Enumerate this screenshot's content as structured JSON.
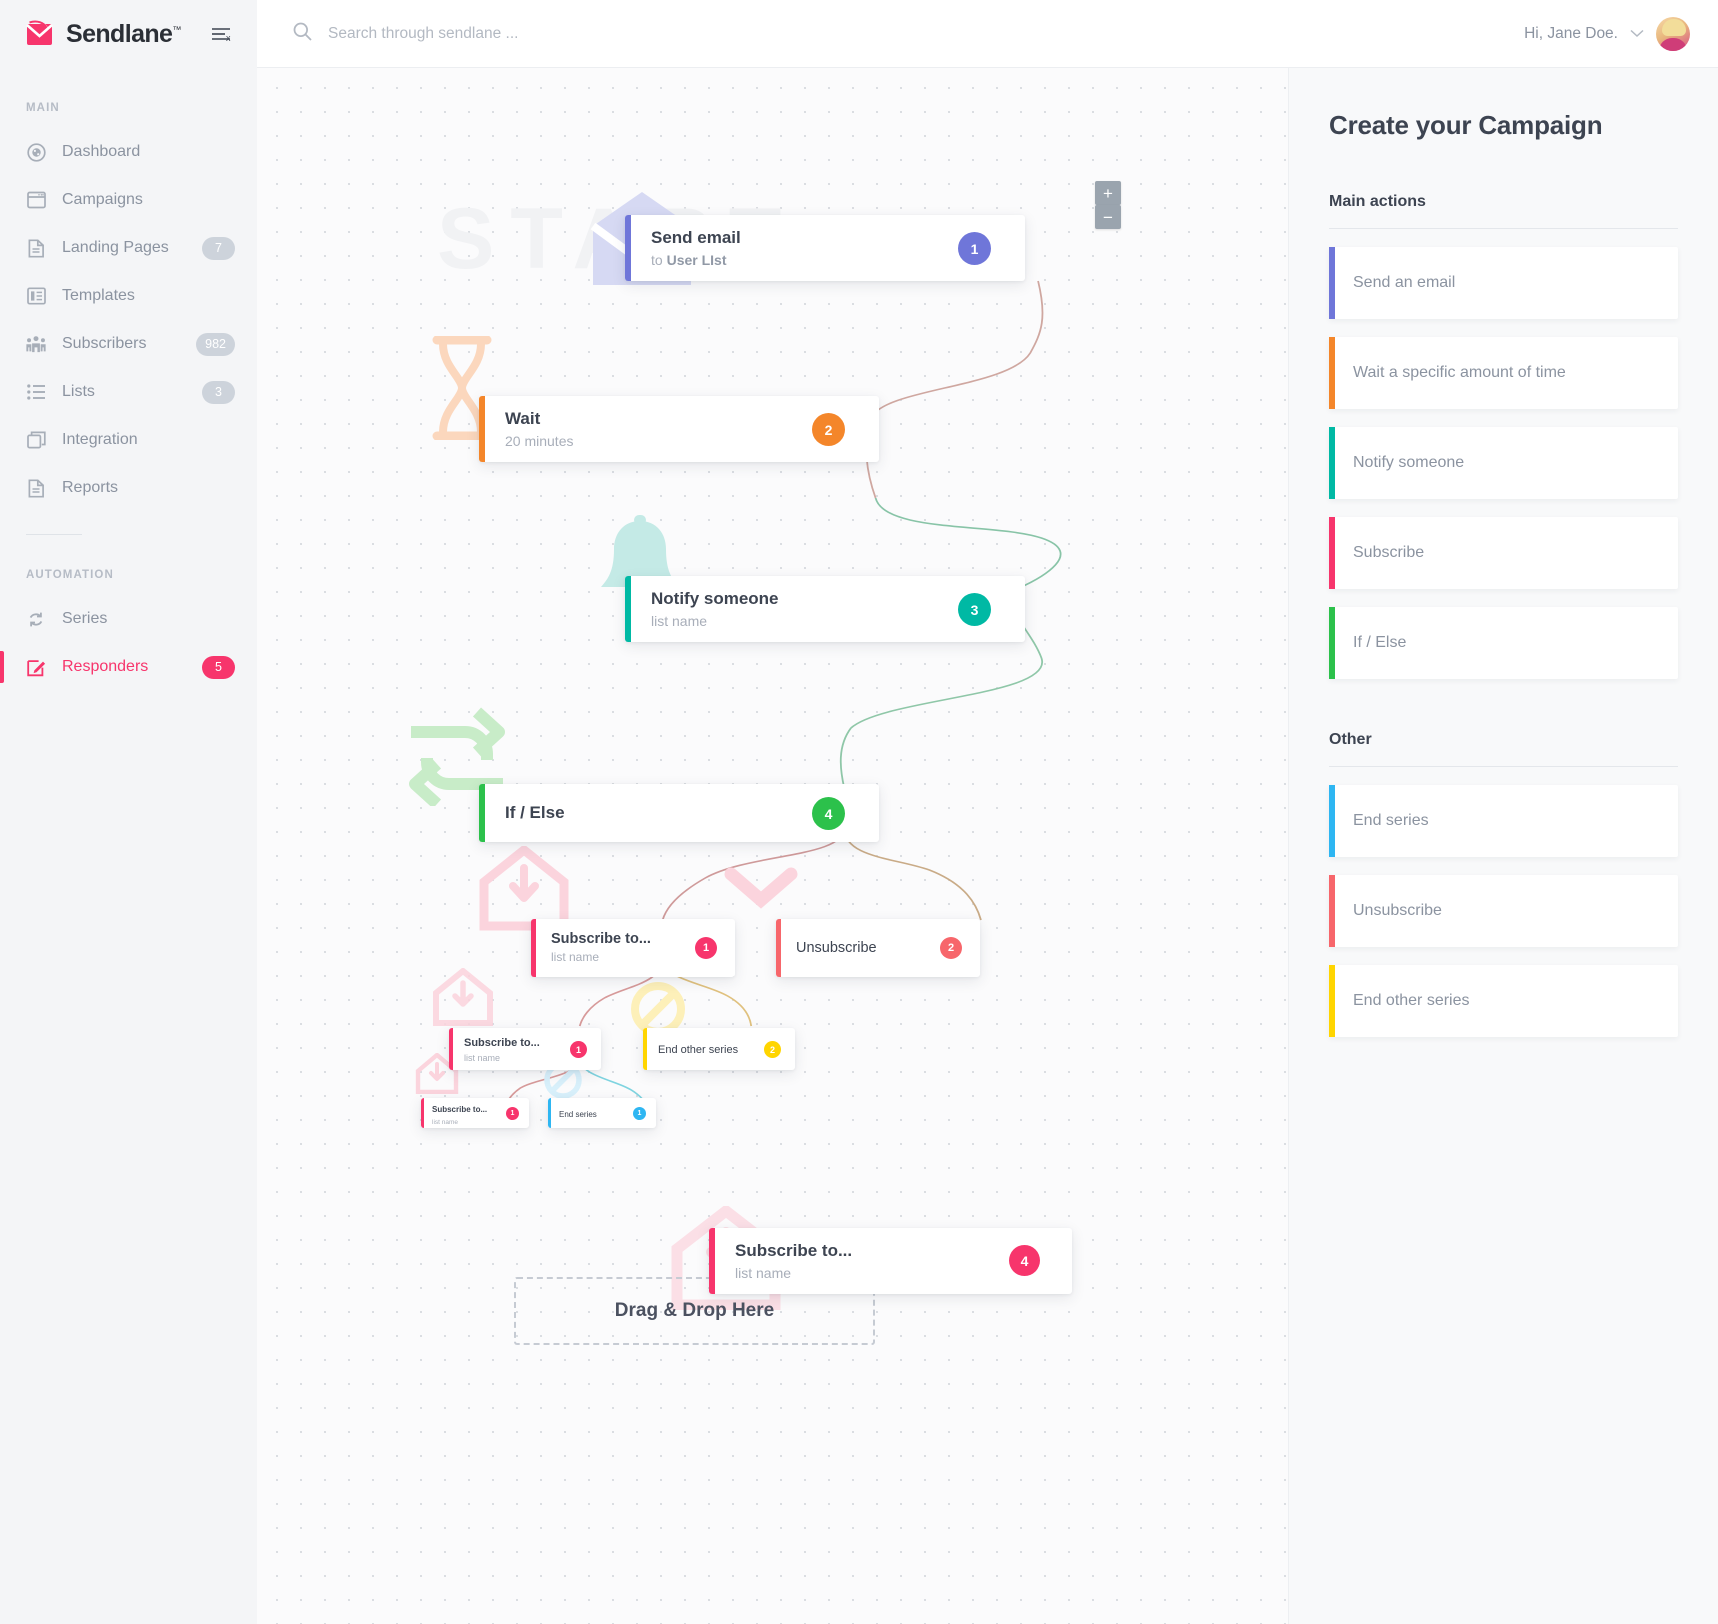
{
  "brand": {
    "name": "Sendlane",
    "tm": "™",
    "collapse_icon": "collapse-sidebar-icon"
  },
  "sidebar": {
    "sections": [
      {
        "label": "MAIN",
        "items": [
          {
            "label": "Dashboard",
            "icon": "speedometer-icon",
            "badge": "",
            "active": false
          },
          {
            "label": "Campaigns",
            "icon": "window-icon",
            "badge": "",
            "active": false
          },
          {
            "label": "Landing Pages",
            "icon": "document-icon",
            "badge": "7",
            "active": false
          },
          {
            "label": "Templates",
            "icon": "layout-icon",
            "badge": "",
            "active": false
          },
          {
            "label": "Subscribers",
            "icon": "people-icon",
            "badge": "982",
            "active": false
          },
          {
            "label": "Lists",
            "icon": "list-icon",
            "badge": "3",
            "active": false
          },
          {
            "label": "Integration",
            "icon": "windows-stack-icon",
            "badge": "",
            "active": false
          },
          {
            "label": "Reports",
            "icon": "report-icon",
            "badge": "",
            "active": false
          }
        ]
      },
      {
        "label": "AUTOMATION",
        "items": [
          {
            "label": "Series",
            "icon": "refresh-cycle-icon",
            "badge": "",
            "active": false
          },
          {
            "label": "Responders",
            "icon": "edit-square-icon",
            "badge": "5",
            "active": true
          }
        ]
      }
    ]
  },
  "topbar": {
    "search_placeholder": "Search through sendlane ...",
    "search_value": "",
    "search_icon": "search-icon",
    "greeting": "Hi, Jane Doe.",
    "chevron_icon": "chevron-down-icon",
    "avatar": "user-avatar"
  },
  "canvas": {
    "watermark": "START",
    "zoom_in": "+",
    "zoom_out": "−",
    "dropzone_label": "Drag & Drop Here",
    "nodes": [
      {
        "id": "n1",
        "title": "Send email",
        "sub_prefix": "to ",
        "sub": "User LIst",
        "badge": "1",
        "color": "#6f76d9",
        "icon": "envelope-open-icon",
        "size": "lg"
      },
      {
        "id": "n2",
        "title": "Wait",
        "sub_prefix": "",
        "sub": "20 minutes",
        "badge": "2",
        "color": "#f4862a",
        "icon": "hourglass-icon",
        "size": "lg"
      },
      {
        "id": "n3",
        "title": "Notify  someone",
        "sub_prefix": "",
        "sub": "list name",
        "badge": "3",
        "color": "#00b9a4",
        "icon": "bell-icon",
        "size": "lg"
      },
      {
        "id": "n4",
        "title": "If / Else",
        "sub_prefix": "",
        "sub": "",
        "badge": "4",
        "color": "#2cc14b",
        "icon": "arrows-split-icon",
        "size": "lg"
      },
      {
        "id": "n5",
        "title": "Subscribe to...",
        "sub_prefix": "",
        "sub": "list name",
        "badge": "1",
        "color": "#f7356c",
        "icon": "envelope-down-icon",
        "size": "md"
      },
      {
        "id": "n6",
        "title": "Unsubscribe",
        "sub_prefix": "",
        "sub": "",
        "badge": "2",
        "color": "#f7666b",
        "icon": "envelope-x-icon",
        "size": "md"
      },
      {
        "id": "n7",
        "title": "Subscribe to...",
        "sub_prefix": "",
        "sub": "list name",
        "badge": "1",
        "color": "#f7356c",
        "icon": "envelope-down-icon",
        "size": "sm"
      },
      {
        "id": "n8",
        "title": "End other series",
        "sub_prefix": "",
        "sub": "",
        "badge": "2",
        "color": "#ffd500",
        "icon": "no-entry-icon",
        "size": "sm"
      },
      {
        "id": "n9",
        "title": "Subscribe to...",
        "sub_prefix": "",
        "sub": "list name",
        "badge": "1",
        "color": "#f7356c",
        "icon": "envelope-down-icon",
        "size": "xs"
      },
      {
        "id": "n10",
        "title": "End series",
        "sub_prefix": "",
        "sub": "",
        "badge": "1",
        "color": "#2eb6f2",
        "icon": "no-entry-icon",
        "size": "xs"
      },
      {
        "id": "n11",
        "title": "Subscribe to...",
        "sub_prefix": "",
        "sub": "list name",
        "badge": "4",
        "color": "#f7356c",
        "icon": "envelope-down-icon",
        "size": "lg"
      }
    ]
  },
  "right_panel": {
    "title": "Create your Campaign",
    "groups": [
      {
        "title": "Main actions",
        "items": [
          {
            "label": "Send an email",
            "color": "#6f76d9"
          },
          {
            "label": "Wait a specific amount of time",
            "color": "#f4862a"
          },
          {
            "label": "Notify  someone",
            "color": "#00b9a4"
          },
          {
            "label": "Subscribe",
            "color": "#f7356c"
          },
          {
            "label": "If / Else",
            "color": "#2cc14b"
          }
        ]
      },
      {
        "title": "Other",
        "items": [
          {
            "label": "End series",
            "color": "#2eb6f2"
          },
          {
            "label": "Unsubscribe",
            "color": "#f7666b"
          },
          {
            "label": "End other series",
            "color": "#ffd500"
          }
        ]
      }
    ]
  }
}
